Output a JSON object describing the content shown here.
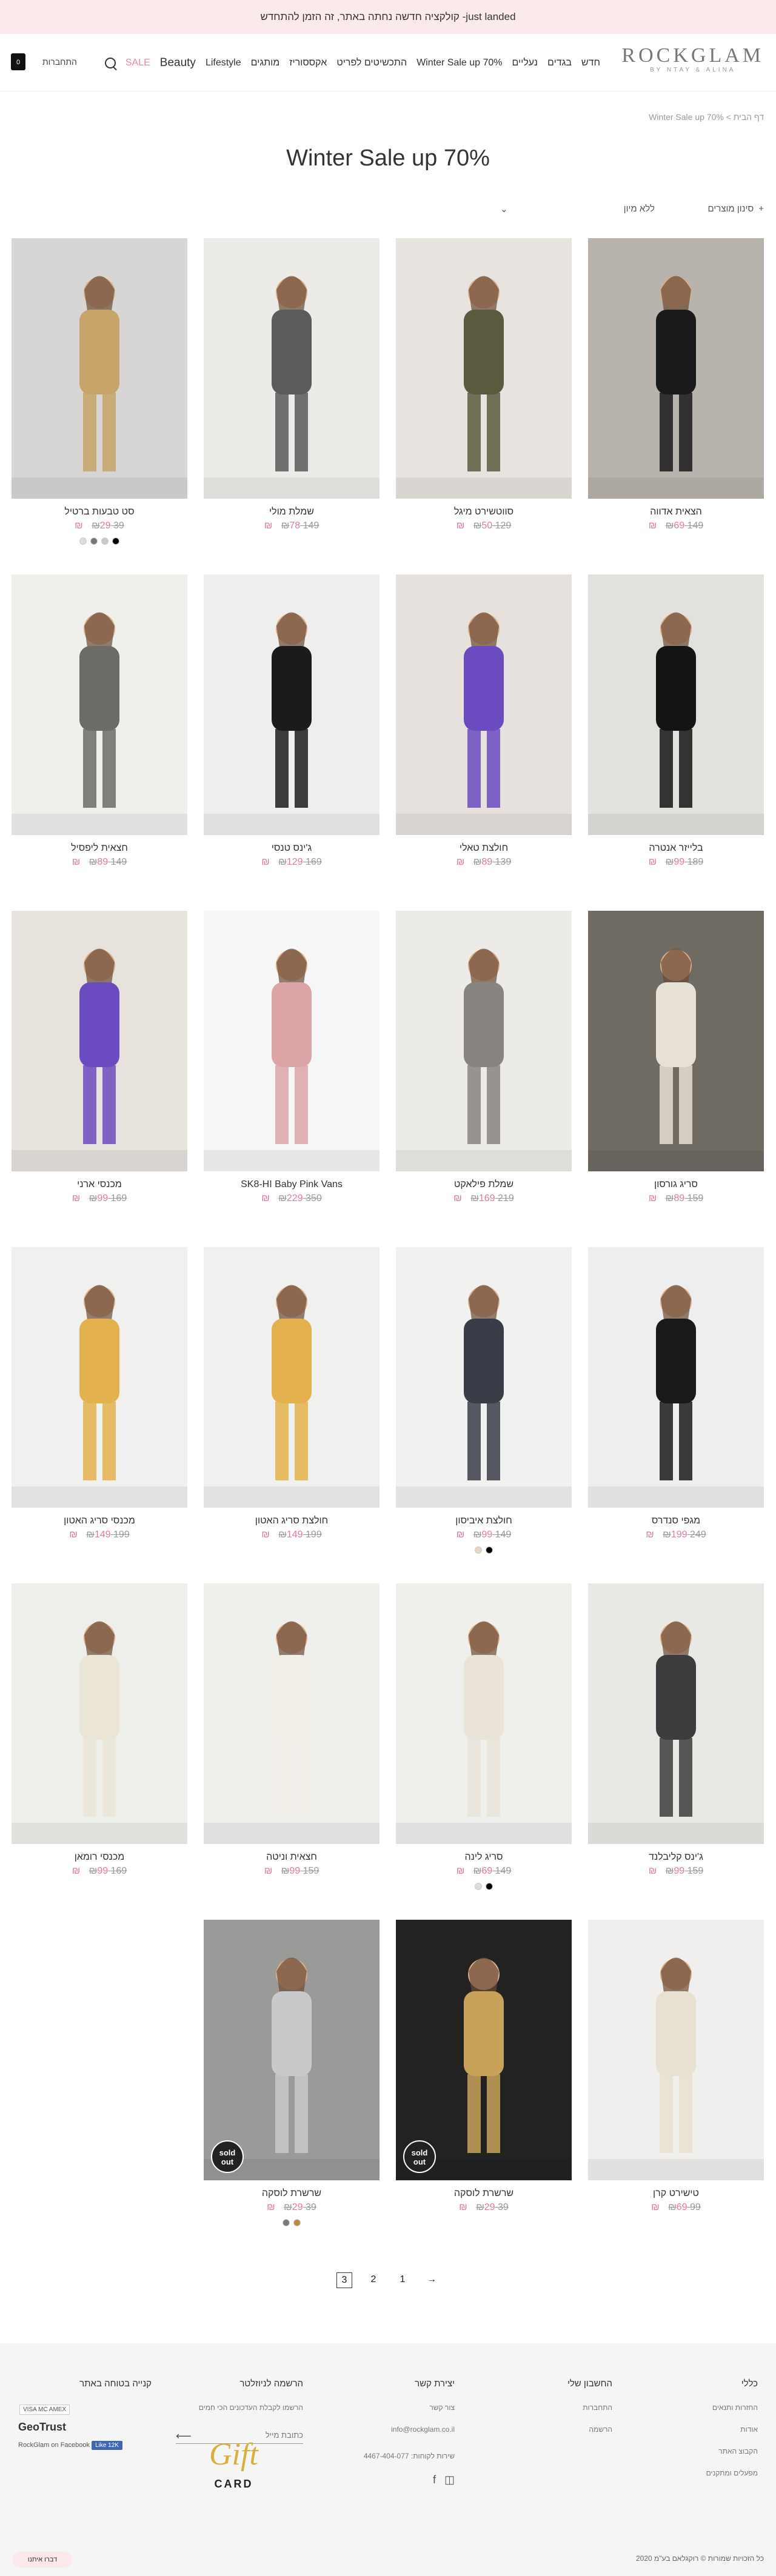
{
  "announcement": "just landed- קולקציה חדשה נחתה באתר, זה הזמן להתחדש",
  "logo": {
    "main": "ROCKGLAM",
    "sub": "BY NTAY & ALINA"
  },
  "nav": [
    "חדש",
    "בגדים",
    "נעליים",
    "Winter Sale up 70%",
    "התכשיטים לפריט",
    "אקססוריז",
    "מותגים",
    "Lifestyle",
    "Beauty",
    "SALE"
  ],
  "header": {
    "login": "התחברות",
    "cart_count": "0"
  },
  "breadcrumb": "דף הבית > Winter Sale up 70%",
  "title": "Winter Sale up 70%",
  "filter": {
    "label": "סינון מוצרים",
    "sort": "ללא מיון"
  },
  "products": [
    {
      "name": "הצאית אדווה",
      "old": "149 ₪",
      "new": "69 ₪",
      "bg": "#b9b3ad",
      "fig": "#1a1a1a",
      "empty": false,
      "sold": false
    },
    {
      "name": "סווטשירט מיגל",
      "old": "129 ₪",
      "new": "50 ₪",
      "bg": "#e7e4e0",
      "fig": "#5a5b3e",
      "empty": false,
      "sold": false
    },
    {
      "name": "שמלת מולי",
      "old": "149 ₪",
      "new": "78 ₪",
      "bg": "#ecebe8",
      "fig": "#5b5b5b",
      "empty": false,
      "sold": false
    },
    {
      "name": "סט טבעות ברטיל",
      "old": "39 ₪",
      "new": "29 ₪",
      "bg": "#d8d6d4",
      "fig": "#c7a56a",
      "empty": false,
      "sold": false
    },
    {
      "name": "בלייזר אנטרה",
      "old": "189 ₪",
      "new": "99 ₪",
      "bg": "#e3e1de",
      "fig": "#141414",
      "empty": false,
      "sold": false
    },
    {
      "name": "חולצת טאלי",
      "old": "139 ₪",
      "new": "89 ₪",
      "bg": "#e6e1dc",
      "fig": "#6b4cc0",
      "empty": false,
      "sold": false
    },
    {
      "name": "ג'ינס טנסי",
      "old": "169 ₪",
      "new": "129 ₪",
      "bg": "#eeeeec",
      "fig": "#1b1b1b",
      "empty": false,
      "sold": false
    },
    {
      "name": "חצאית ליפסיל",
      "old": "149 ₪",
      "new": "89 ₪",
      "bg": "#efefec",
      "fig": "#6c6b66",
      "empty": false,
      "sold": false
    },
    {
      "name": "סריג גורסון",
      "old": "159 ₪",
      "new": "89 ₪",
      "bg": "#6f6a62",
      "fig": "#e7e0d5",
      "empty": false,
      "sold": false
    },
    {
      "name": "שמלת פילאקט",
      "old": "219 ₪",
      "new": "169 ₪",
      "bg": "#ecebe7",
      "fig": "#888480",
      "empty": false,
      "sold": false
    },
    {
      "name": "SK8-HI Baby Pink Vans",
      "old": "350 ₪",
      "new": "229 ₪",
      "bg": "#f6f6f6",
      "fig": "#dba5a8",
      "empty": false,
      "sold": false
    },
    {
      "name": "מכנסי ארני",
      "old": "169 ₪",
      "new": "99 ₪",
      "bg": "#e7e2dc",
      "fig": "#6b4cc0",
      "empty": false,
      "sold": false
    },
    {
      "name": "מגפי סנדרס",
      "old": "249 ₪",
      "new": "199 ₪",
      "bg": "#eeeeee",
      "fig": "#1a1a1a",
      "empty": false,
      "sold": false
    },
    {
      "name": "חולצת איביסון",
      "old": "149 ₪",
      "new": "99 ₪",
      "bg": "#f1f1ef",
      "fig": "#3a3d48",
      "empty": false,
      "sold": false
    },
    {
      "name": "חולצת סריג האטון",
      "old": "199 ₪",
      "new": "149 ₪",
      "bg": "#f0f0ee",
      "fig": "#e3b24e",
      "empty": false,
      "sold": false
    },
    {
      "name": "מכנסי סריג האטון",
      "old": "199 ₪",
      "new": "149 ₪",
      "bg": "#f0f0ee",
      "fig": "#e3b24e",
      "empty": false,
      "sold": false
    },
    {
      "name": "ג'ינס קליבלנד",
      "old": "159 ₪",
      "new": "99 ₪",
      "bg": "#e9e8e5",
      "fig": "#3c3c3e",
      "empty": false,
      "sold": false
    },
    {
      "name": "סריג לינה",
      "old": "149 ₪",
      "new": "69 ₪",
      "bg": "#efefec",
      "fig": "#eae4d8",
      "empty": false,
      "sold": false
    },
    {
      "name": "חצאית וניטה",
      "old": "159 ₪",
      "new": "99 ₪",
      "bg": "#efefec",
      "fig": "#f2efe8",
      "empty": false,
      "sold": false
    },
    {
      "name": "מכנסי רומאן",
      "old": "169 ₪",
      "new": "99 ₪",
      "bg": "#eeeeeb",
      "fig": "#ebe5d8",
      "empty": false,
      "sold": false
    },
    {
      "name": "טישירט קרן",
      "old": "99 ₪",
      "new": "69 ₪",
      "bg": "#f0efed",
      "fig": "#e8e0d1",
      "empty": false,
      "sold": false
    },
    {
      "name": "שרשרת לוסקה",
      "old": "39 ₪",
      "new": "29 ₪",
      "bg": "#222222",
      "fig": "#c8a25a",
      "empty": false,
      "sold": true
    },
    {
      "name": "שרשרת לוסקה",
      "old": "39 ₪",
      "new": "29 ₪",
      "bg": "#9a9a98",
      "fig": "#c9c9c9",
      "empty": false,
      "sold": true
    },
    {
      "name": "",
      "old": "",
      "new": "",
      "bg": "#ffffff",
      "fig": "#ffffff",
      "empty": true,
      "sold": false
    }
  ],
  "sold_label": "sold out",
  "swatches": {
    "p3": [
      "#000000",
      "#c9c9c9",
      "#777777",
      "#dcdcdc"
    ],
    "p13": [
      "#000000",
      "#e7d7c1"
    ],
    "p17": [
      "#000000",
      "#dcdcdc"
    ],
    "p22": [
      "#c08a3e",
      "#777777"
    ],
    "p23": [
      "#c08a3e",
      "#777777"
    ]
  },
  "pager": {
    "pages": [
      "1",
      "2",
      "3"
    ],
    "current": "3",
    "next": "→"
  },
  "footer": {
    "col1": {
      "title": "כללי",
      "links": [
        "החזרות ותנאים",
        "אודות",
        "הקבוצ האתר",
        "מפעלים ומתקנים"
      ]
    },
    "col2": {
      "title": "החשבון שלי",
      "links": [
        "התחברות",
        "הרשמה"
      ]
    },
    "col3": {
      "title": "יצירת קשר",
      "links": [
        "צור קשר",
        "info@rockglam.co.il",
        "שירות לקוחות: 4467-404-077"
      ]
    },
    "col4": {
      "title": "הרשמה לניוזלטר",
      "text": "הרשמו לקבלת העדכונים הכי חמים",
      "email_placeholder": "כתובת מייל"
    },
    "col5": {
      "title": "קנייה בטוחה באתר",
      "trust": "GeoTrust",
      "fb": "RockGlam on Facebook",
      "like": "Like 12K"
    },
    "gift": "Gift",
    "gift_card": "CARD",
    "copyright": "כל הזכויות שמורות © רוקגלאם בע\"מ 2020",
    "chat": "דברו איתנו"
  }
}
